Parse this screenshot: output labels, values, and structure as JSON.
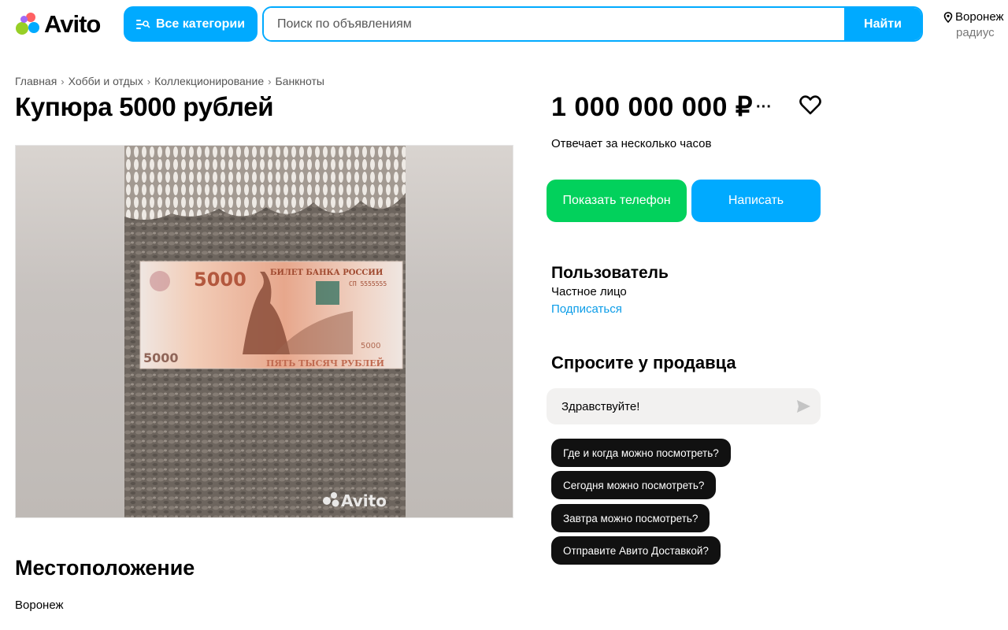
{
  "colors": {
    "accent": "#00aaff",
    "green": "#02d15c",
    "chip": "#111111",
    "link": "#0a9ce8"
  },
  "header": {
    "logo_text": "Avito",
    "categories_button": "Все категории",
    "search_placeholder": "Поиск по объявлениям",
    "search_button": "Найти",
    "location_city": "Воронеж",
    "location_radius": "радиус"
  },
  "breadcrumb": [
    "Главная",
    "Хобби и отдых",
    "Коллекционирование",
    "Банкноты"
  ],
  "listing": {
    "title": "Купюра 5000 рублей",
    "photo_watermark": "Avito",
    "price": "1 000 000 000 ₽",
    "price_more": "···",
    "response_time": "Отвечает за несколько часов",
    "show_phone_button": "Показать телефон",
    "write_button": "Написать"
  },
  "seller": {
    "name": "Пользователь",
    "type": "Частное лицо",
    "subscribe": "Подписаться"
  },
  "ask": {
    "title": "Спросите у продавца",
    "message_value": "Здравствуйте!",
    "quick_questions": [
      "Где и когда можно посмотреть?",
      "Сегодня можно посмотреть?",
      "Завтра можно посмотреть?",
      "Отправите Авито Доставкой?"
    ]
  },
  "location": {
    "title": "Местоположение",
    "city": "Воронеж"
  },
  "banknote": {
    "denomination": "5000",
    "bank_text": "БИЛЕТ БАНКА РОССИИ",
    "serial": "СП 5555555",
    "words": "ПЯТЬ ТЫСЯЧ РУБЛЕЙ"
  },
  "icons": [
    "location-pin-icon",
    "categories-icon",
    "heart-icon",
    "send-icon"
  ]
}
